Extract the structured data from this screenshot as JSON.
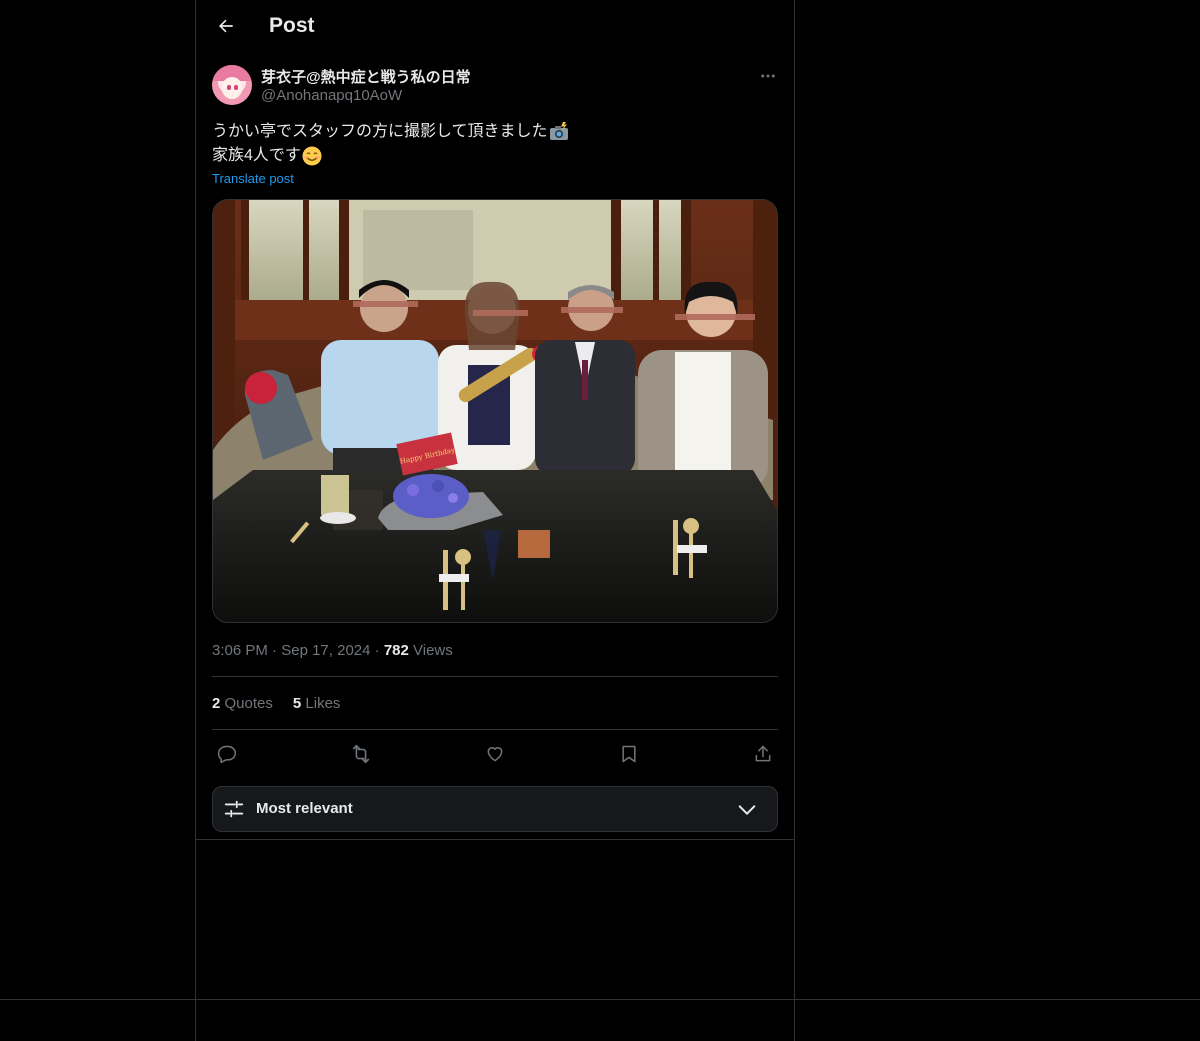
{
  "header": {
    "title": "Post"
  },
  "author": {
    "display_name": "芽衣子@熱中症と戦う私の日常",
    "handle": "@Anohanapq10AoW"
  },
  "post": {
    "line1": "うかい亭でスタッフの方に撮影して頂きました",
    "line1_emoji": "camera-with-flash-emoji",
    "line2": "家族4人です",
    "line2_emoji": "smiling-face-emoji",
    "translate_label": "Translate post",
    "image_card_text": "Happy Birthday"
  },
  "meta": {
    "time": "3:06 PM",
    "separator": "·",
    "date": "Sep 17, 2024",
    "views_count": "782",
    "views_label": "Views"
  },
  "stats": {
    "quotes_count": "2",
    "quotes_label": "Quotes",
    "likes_count": "5",
    "likes_label": "Likes"
  },
  "actions": [
    "reply-icon",
    "repost-icon",
    "like-icon",
    "bookmark-icon",
    "share-icon"
  ],
  "sort": {
    "label": "Most relevant"
  },
  "colors": {
    "background": "#000000",
    "text": "#e7e9ea",
    "secondary": "#71767b",
    "accent": "#1d9bf0",
    "border": "#2f3336"
  }
}
